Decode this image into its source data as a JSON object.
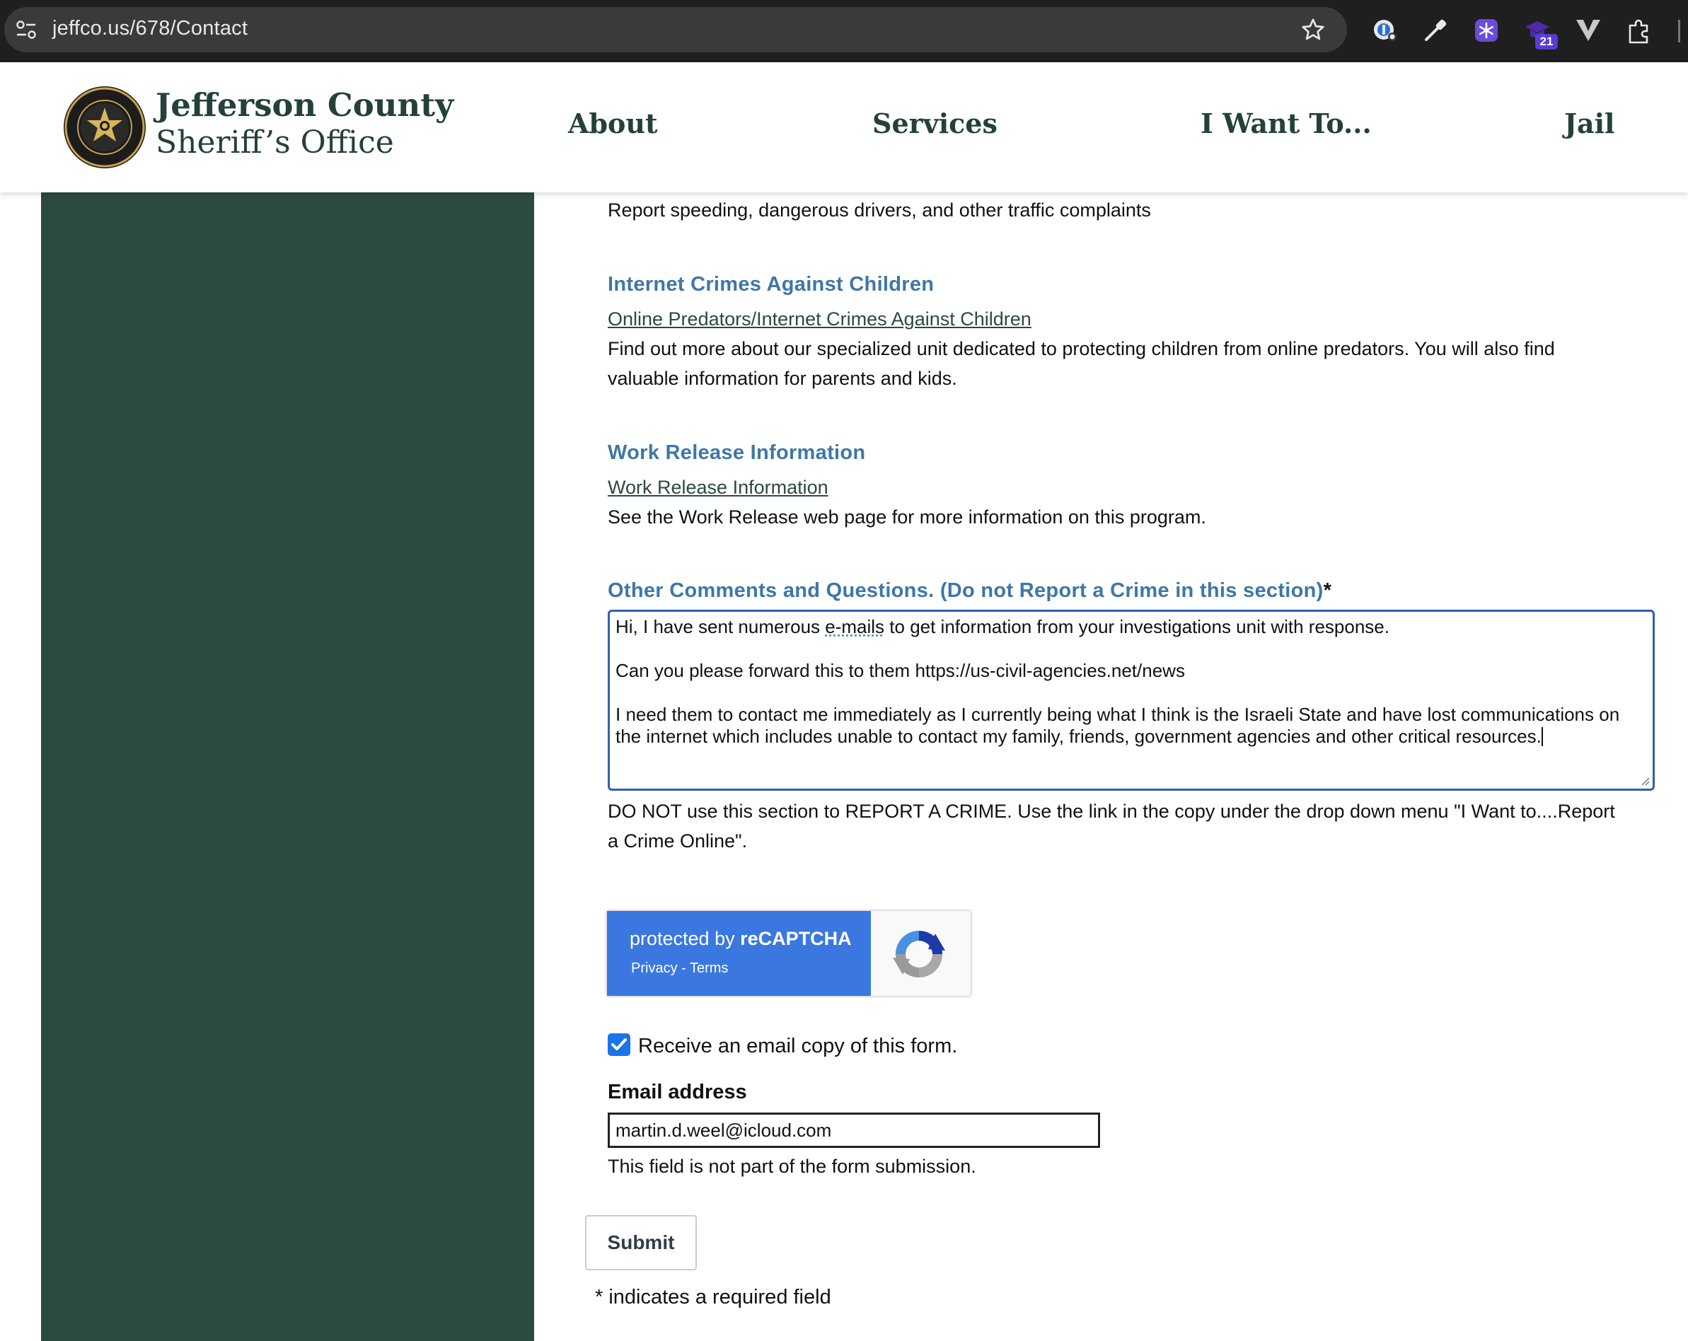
{
  "browser": {
    "url": "jeffco.us/678/Contact",
    "extension_badge": "21"
  },
  "header": {
    "brand_line1": "Jefferson County",
    "brand_line2": "Sheriff’s Office",
    "nav": [
      "About",
      "Services",
      "I Want To...",
      "Jail"
    ]
  },
  "sections": {
    "traffic_desc": "Report speeding, dangerous drivers, and other traffic complaints",
    "icac": {
      "title": "Internet Crimes Against Children",
      "link": "Online Predators/Internet Crimes Against Children",
      "desc": "Find out more about our specialized unit dedicated to protecting children from online predators. You will also find valuable information for parents and kids."
    },
    "work_release": {
      "title": "Work Release Information",
      "link": "Work Release Information",
      "desc": "See the Work Release web page for more information on this program."
    },
    "comments": {
      "title": "Other Comments and Questions. (Do not Report a Crime in this section)",
      "required_mark": "*",
      "para1_before": "Hi, I have sent numerous ",
      "para1_spell": "e-mails",
      "para1_after": " to get information from your investigations unit with response.",
      "para2": "Can you please forward this to them https://us-civil-agencies.net/news",
      "para3": "I need them to contact me immediately as I currently being what I think is the Israeli State and have lost communications on the internet which includes unable to contact my family, friends, government agencies and other critical resources.",
      "help": "DO NOT use this section to REPORT A CRIME. Use the link in the copy under the drop down menu \"I Want to....Report a Crime Online\"."
    }
  },
  "recaptcha": {
    "protected_by": "protected by ",
    "brand": "reCAPTCHA",
    "links": "Privacy - Terms"
  },
  "email_copy": {
    "checkbox_label": "Receive an email copy of this form.",
    "checked": true,
    "field_label": "Email address",
    "value": "martin.d.weel@icloud.com",
    "note": "This field is not part of the form submission."
  },
  "submit_label": "Submit",
  "required_note": "* indicates a required field",
  "colors": {
    "sidebar": "#2b4a42",
    "heading_blue": "#3e77a6",
    "brand_green": "#23413a",
    "focus_blue": "#2f5fb8",
    "recaptcha_blue": "#3a78e0"
  }
}
